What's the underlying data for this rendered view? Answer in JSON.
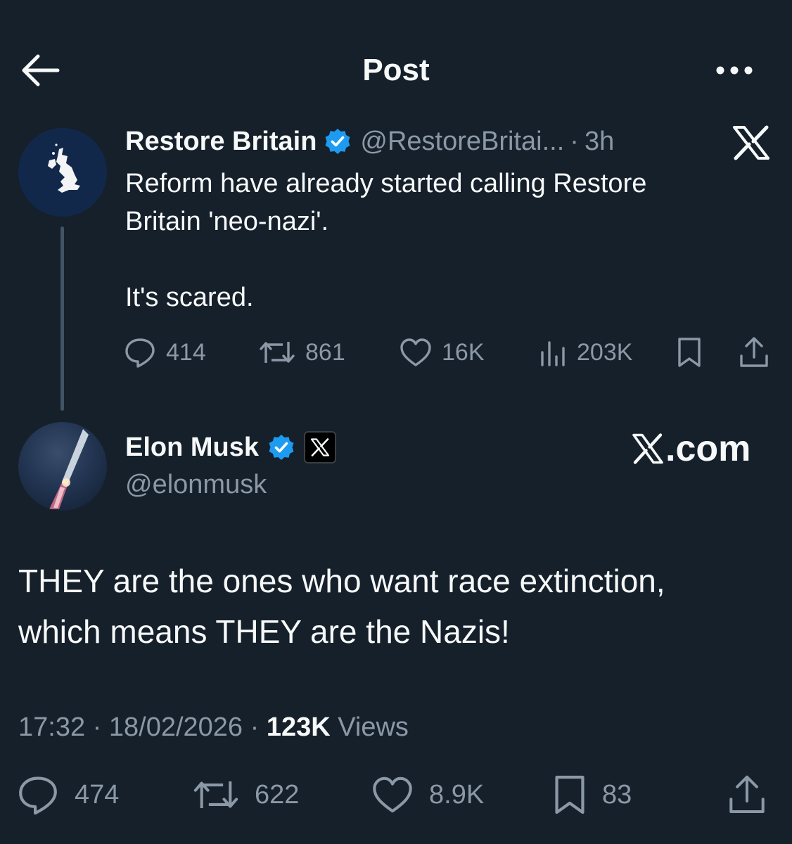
{
  "header": {
    "title": "Post"
  },
  "quoted_post": {
    "author_name": "Restore Britain",
    "handle": "@RestoreBritai...",
    "separator": "·",
    "time": "3h",
    "text_line1": "Reform have already started calling Restore",
    "text_line2": "Britain 'neo-nazi'.",
    "text_line3": "It's scared.",
    "replies": "414",
    "reposts": "861",
    "likes": "16K",
    "views": "203K"
  },
  "main_post": {
    "author_name": "Elon Musk",
    "handle": "@elonmusk",
    "brand_label": ".com",
    "text_line1": "THEY are the ones who want race extinction,",
    "text_line2": "which means THEY are the Nazis!",
    "time": "17:32",
    "date": "18/02/2026",
    "dot": "·",
    "views_count": "123K",
    "views_label": "Views",
    "replies": "474",
    "reposts": "622",
    "likes": "8.9K",
    "bookmarks": "83"
  },
  "colors": {
    "background": "#15202b",
    "text_primary": "#f7f9f9",
    "text_muted": "#8b98a5",
    "verified_blue": "#1d9bf0",
    "thread_line": "#425364"
  },
  "icons": [
    "back-arrow-icon",
    "more-icon",
    "verified-badge-icon",
    "x-logo-icon",
    "reply-icon",
    "repost-icon",
    "like-icon",
    "views-icon",
    "bookmark-icon",
    "share-icon"
  ]
}
